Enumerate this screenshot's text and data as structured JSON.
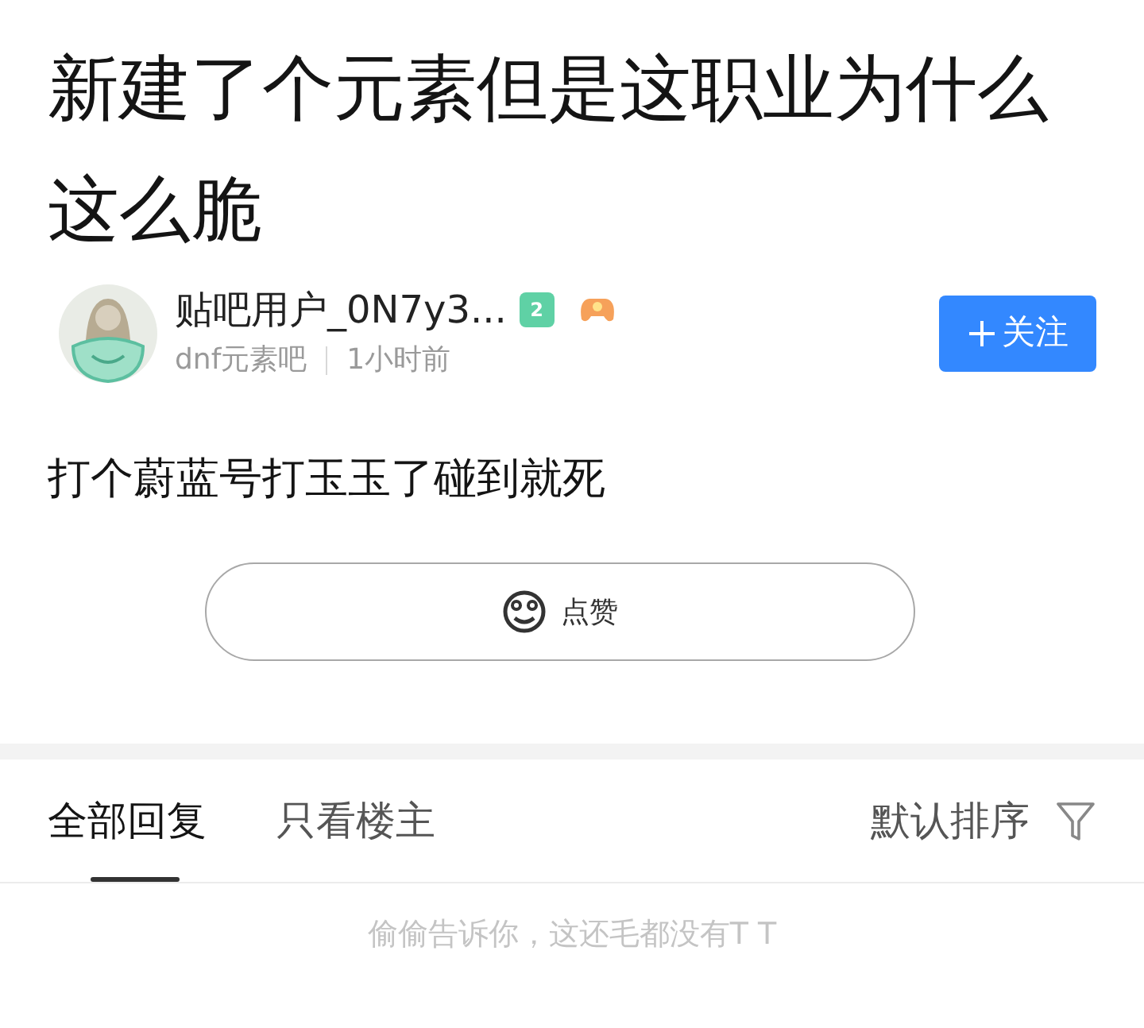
{
  "post": {
    "title": "新建了个元素但是这职业为什么这么脆",
    "author": {
      "name": "贴吧用户_0N7y3...",
      "level": "2",
      "forum": "dnf元素吧",
      "time": "1小时前"
    },
    "follow_button": "关注",
    "body": "打个蔚蓝号打玉玉了碰到就死",
    "like_button": "点赞"
  },
  "tabs": [
    {
      "label": "全部回复",
      "selected": true
    },
    {
      "label": "只看楼主",
      "selected": false
    }
  ],
  "sort": "默认排序",
  "empty_message": "偷偷告诉你，这还毛都没有T T"
}
